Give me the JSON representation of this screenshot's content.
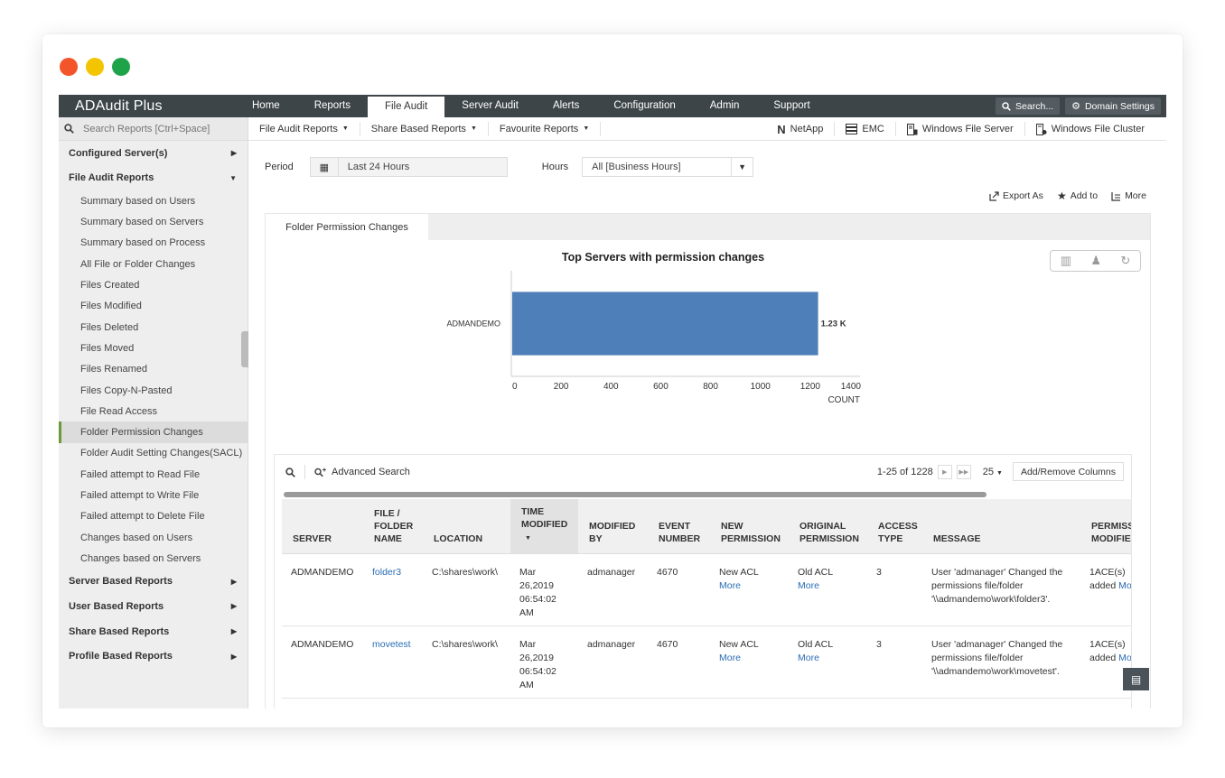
{
  "window": {
    "dots": [
      "#f4542a",
      "#f3c500",
      "#1fa34a"
    ]
  },
  "topnav": {
    "brand": "ADAudit Plus",
    "tabs": [
      "Home",
      "Reports",
      "File Audit",
      "Server Audit",
      "Alerts",
      "Configuration",
      "Admin",
      "Support"
    ],
    "active_tab": "File Audit",
    "search_label": "Search...",
    "domain_label": "Domain Settings"
  },
  "subbar": {
    "left": [
      "File Audit Reports",
      "Share Based Reports",
      "Favourite Reports"
    ],
    "right": [
      "NetApp",
      "EMC",
      "Windows File Server",
      "Windows File Cluster"
    ]
  },
  "sidebar": {
    "search_placeholder": "Search Reports [Ctrl+Space]",
    "configured": "Configured Server(s)",
    "file_audit_group": "File Audit Reports",
    "items": [
      "Summary based on Users",
      "Summary based on Servers",
      "Summary based on Process",
      "All File or Folder Changes",
      "Files Created",
      "Files Modified",
      "Files Deleted",
      "Files Moved",
      "Files Renamed",
      "Files Copy-N-Pasted",
      "File Read Access",
      "Folder Permission Changes",
      "Folder Audit Setting Changes(SACL)",
      "Failed attempt to Read File",
      "Failed attempt to Write File",
      "Failed attempt to Delete File",
      "Changes based on Users",
      "Changes based on Servers"
    ],
    "active_item": "Folder Permission Changes",
    "groups": [
      "Server Based Reports",
      "User Based Reports",
      "Share Based Reports",
      "Profile Based Reports"
    ]
  },
  "filters": {
    "period_label": "Period",
    "period_value": "Last 24 Hours",
    "hours_label": "Hours",
    "hours_value": "All [Business Hours]"
  },
  "actions": {
    "export": "Export As",
    "add": "Add to",
    "more": "More"
  },
  "panel": {
    "tab": "Folder Permission Changes"
  },
  "chart_data": {
    "type": "bar",
    "orientation": "horizontal",
    "title": "Top Servers with permission changes",
    "categories": [
      "ADMANDEMO"
    ],
    "values": [
      1228
    ],
    "data_labels": [
      "1.23 K"
    ],
    "xlabel": "COUNT",
    "xlim": [
      0,
      1400
    ],
    "xticks": [
      "0",
      "200",
      "400",
      "600",
      "800",
      "1000",
      "1200",
      "1400"
    ],
    "grid": false,
    "bar_color": "#4f7fb8"
  },
  "grid": {
    "advanced_search": "Advanced Search",
    "page_info": "1-25 of 1228",
    "page_size": "25",
    "add_remove": "Add/Remove Columns",
    "columns": [
      [
        "SERVER"
      ],
      [
        "FILE /",
        "FOLDER",
        "NAME"
      ],
      [
        "LOCATION"
      ],
      [
        "TIME",
        "MODIFIED"
      ],
      [
        "MODIFIED",
        "BY"
      ],
      [
        "EVENT",
        "NUMBER"
      ],
      [
        "NEW",
        "PERMISSION"
      ],
      [
        "ORIGINAL",
        "PERMISSION"
      ],
      [
        "ACCESS",
        "TYPE"
      ],
      [
        "MESSAGE"
      ],
      [
        "PERMISSIONS",
        "MODIFIED"
      ]
    ],
    "rows": [
      {
        "server": "ADMANDEMO",
        "file": "folder3",
        "location": "C:\\shares\\work\\",
        "time": [
          "Mar",
          "26,2019",
          "06:54:02",
          "AM"
        ],
        "by": "admanager",
        "event": "4670",
        "new_perm": "New ACL",
        "orig_perm": "Old ACL",
        "more": "More",
        "access": "3",
        "message": [
          "User 'admanager' Changed the",
          "permissions file/folder",
          "'\\\\admandemo\\work\\folder3'."
        ],
        "perm_mod": [
          "1ACE(s)",
          "added"
        ],
        "perm_more": "More"
      },
      {
        "server": "ADMANDEMO",
        "file": "movetest",
        "location": "C:\\shares\\work\\",
        "time": [
          "Mar",
          "26,2019",
          "06:54:02",
          "AM"
        ],
        "by": "admanager",
        "event": "4670",
        "new_perm": "New ACL",
        "orig_perm": "Old ACL",
        "more": "More",
        "access": "3",
        "message": [
          "User 'admanager' Changed the",
          "permissions file/folder",
          "'\\\\admandemo\\work\\movetest'."
        ],
        "perm_mod": [
          "1ACE(s)",
          "added"
        ],
        "perm_more": "More"
      }
    ]
  }
}
